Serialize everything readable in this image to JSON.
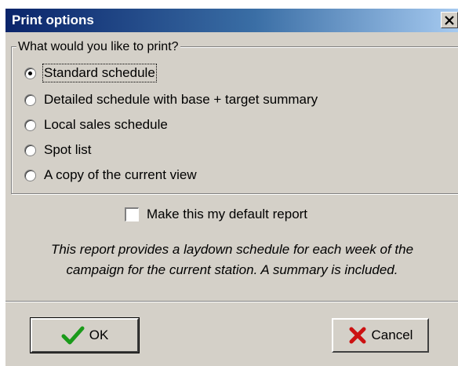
{
  "window": {
    "title": "Print options",
    "close_glyph": "✕"
  },
  "group": {
    "legend": "What would you like to print?",
    "options": [
      {
        "label": "Standard schedule",
        "checked": true
      },
      {
        "label": "Detailed schedule with base + target summary",
        "checked": false
      },
      {
        "label": "Local sales schedule",
        "checked": false
      },
      {
        "label": "Spot list",
        "checked": false
      },
      {
        "label": "A copy of the current view",
        "checked": false
      }
    ]
  },
  "default_checkbox": {
    "label": "Make this my default report",
    "checked": false
  },
  "description": {
    "line1": "This report provides a laydown schedule for each week of the",
    "line2": "campaign for the current station. A summary is included."
  },
  "buttons": {
    "ok_label": "OK",
    "ok_icon": "green-check-icon",
    "cancel_label": "Cancel",
    "cancel_icon": "red-x-icon"
  },
  "colors": {
    "dialog_bg": "#d4d0c8",
    "title_gradient_start": "#0a246a",
    "ok_check": "#1a9a1a",
    "cancel_x": "#cc1111"
  }
}
